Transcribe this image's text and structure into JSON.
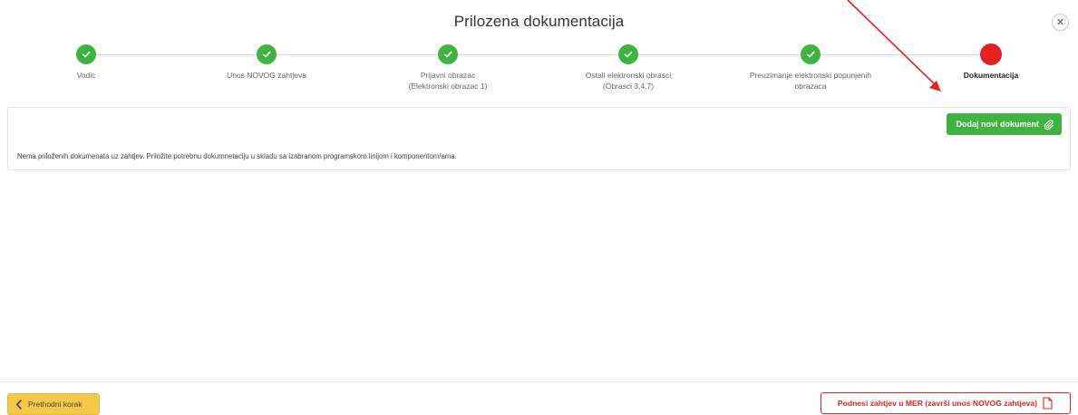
{
  "header": {
    "title": "Prilozena dokumentacija",
    "close_icon": "close-icon"
  },
  "stepper": {
    "steps": [
      {
        "label_line1": "Vodic",
        "label_line2": "",
        "state": "done"
      },
      {
        "label_line1": "Unos NOVOG zahtjeva",
        "label_line2": "",
        "state": "done"
      },
      {
        "label_line1": "Prijavni obrazac",
        "label_line2": "(Elektronski obrazac 1)",
        "state": "done"
      },
      {
        "label_line1": "Ostali elektronski obrasci",
        "label_line2": "(Obrasci 3,4,7)",
        "state": "done"
      },
      {
        "label_line1": "Preuzimanje elektronski popunjenih",
        "label_line2": "obrazaca",
        "state": "done"
      },
      {
        "label_line1": "Dokumentacija",
        "label_line2": "",
        "state": "active"
      }
    ]
  },
  "panel": {
    "add_button_label": "Dodaj novi dokument",
    "add_button_icon": "paperclip-icon",
    "empty_message": "Nema priloženih dokumenata uz zahtjev. Priložite potrebnu dokumnetaciju u skladu sa izabranom programskom linijom i komponentom/ama."
  },
  "footer": {
    "prev_button_label": "Prethodni korak",
    "prev_button_icon": "chevron-left-icon",
    "submit_button_label": "Podnesi zahtjev u MER (završi unos NOVOG zahtjeva)",
    "submit_button_icon": "document-icon"
  },
  "colors": {
    "done": "#3fb33f",
    "active": "#e52222",
    "warning": "#f5c84a",
    "annotation_arrow": "#e52222"
  }
}
